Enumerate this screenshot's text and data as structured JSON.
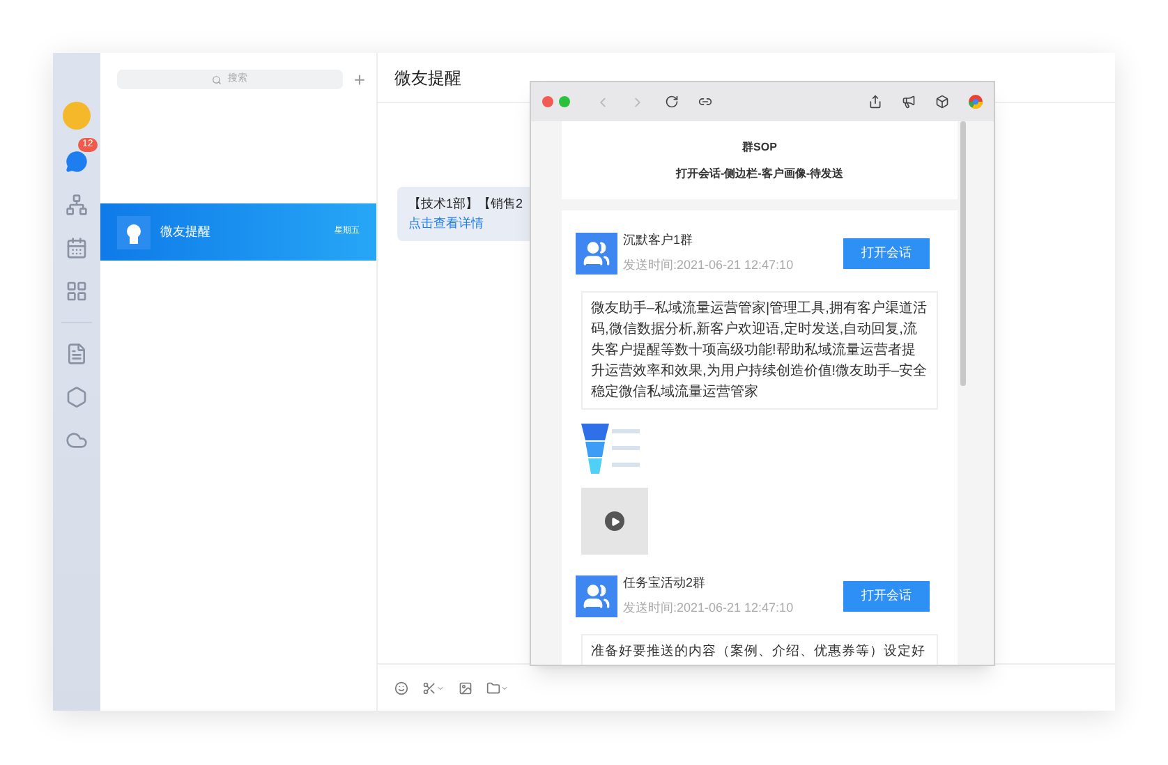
{
  "rail": {
    "badge": "12",
    "items": [
      {
        "kind": "chat",
        "selected": true
      },
      {
        "kind": "org",
        "selected": false
      },
      {
        "kind": "calendar",
        "selected": false
      },
      {
        "kind": "apps",
        "selected": false
      },
      {
        "kind": "doc",
        "selected": false
      },
      {
        "kind": "meeting",
        "selected": false
      },
      {
        "kind": "cloud",
        "selected": false
      }
    ]
  },
  "search": {
    "placeholder": "搜索",
    "add": "+"
  },
  "conversations": [
    {
      "name": "微友提醒",
      "time": "星期五",
      "selected": true
    }
  ],
  "chat": {
    "title": "微友提醒",
    "message": {
      "text": "【技术1部】【销售2",
      "link": "点击查看详情"
    }
  },
  "popup": {
    "title": "群SOP",
    "subtitle": "打开会话-侧边栏-客户画像-待发送",
    "groups": [
      {
        "name": "沉默客户1群",
        "time": "发送时间:2021-06-21 12:47:10",
        "button": "打开会话",
        "content": "微友助手–私域流量运营管家|管理工具,拥有客户渠道活码,微信数据分析,新客户欢迎语,定时发送,自动回复,流失客户提醒等数十项高级功能!帮助私域流量运营者提升运营效率和效果,为用户持续创造价值!微友助手–安全稳定微信私域流量运营管家",
        "attachments": [
          {
            "kind": "funnel"
          },
          {
            "kind": "video"
          }
        ]
      },
      {
        "name": "任务宝活动2群",
        "time": "发送时间:2021-06-21 12:47:10",
        "button": "打开会话",
        "content": "准备好要推送的内容（案例、介绍、优惠券等）设定好"
      }
    ]
  }
}
